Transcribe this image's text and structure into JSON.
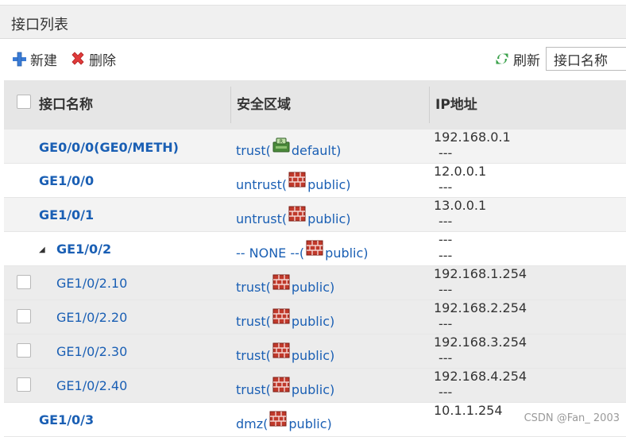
{
  "panel": {
    "title": "接口列表"
  },
  "toolbar": {
    "new_label": "新建",
    "delete_label": "删除",
    "refresh_label": "刷新",
    "search_placeholder": "接口名称"
  },
  "table": {
    "headers": {
      "name": "接口名称",
      "zone": "安全区域",
      "ip": "IP地址"
    },
    "rows": [
      {
        "name": "GE0/0/0(GE0/METH)",
        "zone_prefix": "trust(",
        "zone_icon": "vsys-default-icon",
        "zone_suffix": " default)",
        "ip1": "192.168.0.1",
        "ip2": "---"
      },
      {
        "name": "GE1/0/0",
        "zone_prefix": "untrust(",
        "zone_icon": "firewall-icon",
        "zone_suffix": " public)",
        "ip1": "12.0.0.1",
        "ip2": "---"
      },
      {
        "name": "GE1/0/1",
        "zone_prefix": "untrust(",
        "zone_icon": "firewall-icon",
        "zone_suffix": " public)",
        "ip1": "13.0.0.1",
        "ip2": "---"
      },
      {
        "name": "GE1/0/2",
        "zone_prefix": "-- NONE --(",
        "zone_icon": "firewall-icon",
        "zone_suffix": " public)",
        "ip1": "---",
        "ip2": "---"
      },
      {
        "name": "GE1/0/2.10",
        "zone_prefix": "trust(",
        "zone_icon": "firewall-icon",
        "zone_suffix": " public)",
        "ip1": "192.168.1.254",
        "ip2": "---"
      },
      {
        "name": "GE1/0/2.20",
        "zone_prefix": "trust(",
        "zone_icon": "firewall-icon",
        "zone_suffix": " public)",
        "ip1": "192.168.2.254",
        "ip2": "---"
      },
      {
        "name": "GE1/0/2.30",
        "zone_prefix": "trust(",
        "zone_icon": "firewall-icon",
        "zone_suffix": " public)",
        "ip1": "192.168.3.254",
        "ip2": "---"
      },
      {
        "name": "GE1/0/2.40",
        "zone_prefix": "trust(",
        "zone_icon": "firewall-icon",
        "zone_suffix": " public)",
        "ip1": "192.168.4.254",
        "ip2": "---"
      },
      {
        "name": "GE1/0/3",
        "zone_prefix": "dmz(",
        "zone_icon": "firewall-icon",
        "zone_suffix": " public)",
        "ip1": "10.1.1.254",
        "ip2": ""
      }
    ]
  },
  "watermark": "CSDN @Fan_ 2003",
  "colors": {
    "link": "#1a5fb4",
    "header_bg": "#e6e6e6",
    "title_bg": "#f0f0f0"
  }
}
